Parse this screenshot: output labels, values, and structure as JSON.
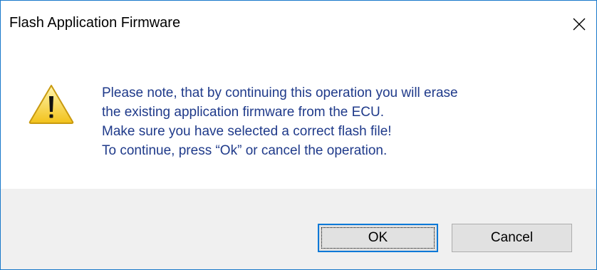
{
  "window": {
    "title": "Flash Application Firmware",
    "close_icon": "close-icon"
  },
  "message": {
    "icon": "warning-icon",
    "lines": [
      "Please note, that by continuing this operation you will erase",
      "the existing application firmware from the ECU.",
      "Make sure you have selected a correct flash file!",
      "To continue, press “Ok” or cancel the operation."
    ]
  },
  "buttons": {
    "ok_label": "OK",
    "cancel_label": "Cancel"
  },
  "colors": {
    "message_text": "#1f3a8a",
    "footer_bg": "#f0f0f0",
    "window_border": "#1979ca",
    "default_button_border": "#0078d7"
  }
}
